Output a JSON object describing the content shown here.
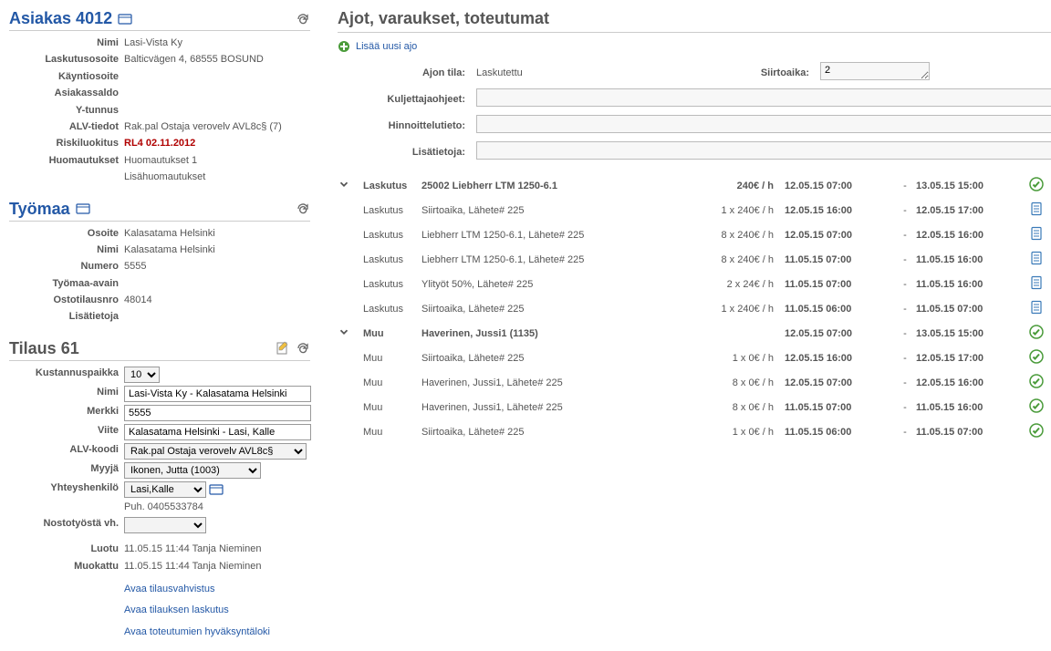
{
  "customer": {
    "title": "Asiakas 4012",
    "fields": {
      "nimi_label": "Nimi",
      "nimi": "Lasi-Vista Ky",
      "laskutus_label": "Laskutusosoite",
      "laskutus": "Balticvägen 4, 68555 BOSUND",
      "kaynti_label": "Käyntiosoite",
      "kaynti": "",
      "asiakassaldo_label": "Asiakassaldo",
      "asiakassaldo": "",
      "ytunnus_label": "Y-tunnus",
      "ytunnus": "",
      "alv_label": "ALV-tiedot",
      "alv": "Rak.pal Ostaja verovelv AVL8c§ (7)",
      "riski_label": "Riskiluokitus",
      "riski": "RL4 02.11.2012",
      "huom_label": "Huomautukset",
      "huom1": "Huomautukset 1",
      "huom2": "Lisähuomautukset"
    }
  },
  "site": {
    "title": "Työmaa",
    "fields": {
      "osoite_label": "Osoite",
      "osoite": "Kalasatama Helsinki",
      "nimi_label": "Nimi",
      "nimi": "Kalasatama Helsinki",
      "numero_label": "Numero",
      "numero": "5555",
      "avain_label": "Työmaa-avain",
      "avain": "",
      "ostotilaus_label": "Ostotilausnro",
      "ostotilaus": "48014",
      "lisa_label": "Lisätietoja",
      "lisa": ""
    }
  },
  "order": {
    "title": "Tilaus 61",
    "fields": {
      "kustannus_label": "Kustannuspaikka",
      "kustannus": "10",
      "nimi_label": "Nimi",
      "nimi": "Lasi-Vista Ky - Kalasatama Helsinki",
      "merkki_label": "Merkki",
      "merkki": "5555",
      "viite_label": "Viite",
      "viite": "Kalasatama Helsinki - Lasi, Kalle",
      "alvkoodi_label": "ALV-koodi",
      "alvkoodi": "Rak.pal Ostaja verovelv AVL8c§",
      "myyja_label": "Myyjä",
      "myyja": "Ikonen, Jutta (1003)",
      "yhteys_label": "Yhteyshenkilö",
      "yhteys": "Lasi,Kalle",
      "puh": "Puh. 0405533784",
      "nosto_label": "Nostotyöstä vh.",
      "nosto": "",
      "luotu_label": "Luotu",
      "luotu": "11.05.15 11:44 Tanja Nieminen",
      "muokattu_label": "Muokattu",
      "muokattu": "11.05.15 11:44 Tanja Nieminen",
      "link1": "Avaa tilausvahvistus",
      "link2": "Avaa tilauksen laskutus",
      "link3": "Avaa toteutumien hyväksyntäloki"
    }
  },
  "right": {
    "title": "Ajot, varaukset, toteutumat",
    "add_link": "Lisää uusi ajo",
    "form": {
      "tila_label": "Ajon tila:",
      "tila": "Laskutettu",
      "siirto_label": "Siirtoaika:",
      "siirto": "2",
      "kulj_label": "Kuljettajaohjeet:",
      "kulj": "",
      "hinn_label": "Hinnoittelutieto:",
      "hinn": "",
      "lisa_label": "Lisätietoja:",
      "lisa": ""
    },
    "rows": [
      {
        "chev": true,
        "type": "Laskutus",
        "desc": "25002 Liebherr LTM 1250-6.1",
        "rate": "240€ / h",
        "d1": "12.05.15 07:00",
        "d2": "13.05.15 15:00",
        "status": "green",
        "edit": true,
        "bold": true
      },
      {
        "chev": false,
        "type": "Laskutus",
        "desc": "Siirtoaika, Lähete# 225",
        "rate": "1 x 240€ / h",
        "d1": "12.05.15 16:00",
        "d2": "12.05.15 17:00",
        "status": "doc",
        "edit": true
      },
      {
        "chev": false,
        "type": "Laskutus",
        "desc": "Liebherr LTM 1250-6.1, Lähete# 225",
        "rate": "8 x 240€ / h",
        "d1": "12.05.15 07:00",
        "d2": "12.05.15 16:00",
        "status": "doc",
        "edit": true
      },
      {
        "chev": false,
        "type": "Laskutus",
        "desc": "Liebherr LTM 1250-6.1, Lähete# 225",
        "rate": "8 x 240€ / h",
        "d1": "11.05.15 07:00",
        "d2": "11.05.15 16:00",
        "status": "doc",
        "edit": true
      },
      {
        "chev": false,
        "type": "Laskutus",
        "desc": "Ylityöt 50%, Lähete# 225",
        "rate": "2 x 24€ / h",
        "d1": "11.05.15 07:00",
        "d2": "11.05.15 16:00",
        "status": "doc",
        "edit": true
      },
      {
        "chev": false,
        "type": "Laskutus",
        "desc": "Siirtoaika, Lähete# 225",
        "rate": "1 x 240€ / h",
        "d1": "11.05.15 06:00",
        "d2": "11.05.15 07:00",
        "status": "doc",
        "edit": true
      },
      {
        "chev": true,
        "type": "Muu",
        "desc": "Haverinen, Jussi1 (1135)",
        "rate": "",
        "d1": "12.05.15 07:00",
        "d2": "13.05.15 15:00",
        "status": "green",
        "edit": true,
        "bold": true
      },
      {
        "chev": false,
        "type": "Muu",
        "desc": "Siirtoaika, Lähete# 225",
        "rate": "1 x 0€ / h",
        "d1": "12.05.15 16:00",
        "d2": "12.05.15 17:00",
        "status": "green",
        "edit": true
      },
      {
        "chev": false,
        "type": "Muu",
        "desc": "Haverinen, Jussi1, Lähete# 225",
        "rate": "8 x 0€ / h",
        "d1": "12.05.15 07:00",
        "d2": "12.05.15 16:00",
        "status": "green",
        "edit": true
      },
      {
        "chev": false,
        "type": "Muu",
        "desc": "Haverinen, Jussi1, Lähete# 225",
        "rate": "8 x 0€ / h",
        "d1": "11.05.15 07:00",
        "d2": "11.05.15 16:00",
        "status": "green",
        "edit": true
      },
      {
        "chev": false,
        "type": "Muu",
        "desc": "Siirtoaika, Lähete# 225",
        "rate": "1 x 0€ / h",
        "d1": "11.05.15 06:00",
        "d2": "11.05.15 07:00",
        "status": "green",
        "edit": true
      }
    ]
  }
}
